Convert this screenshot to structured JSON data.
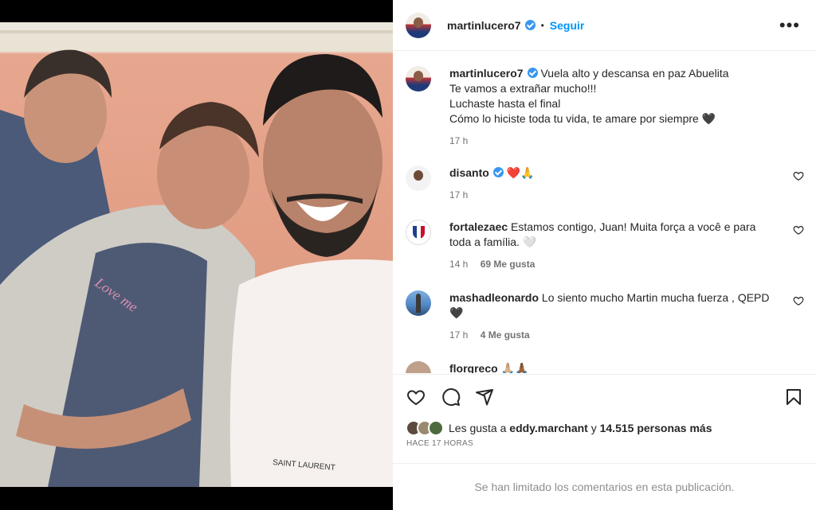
{
  "post": {
    "author": "martinlucero7",
    "follow_label": "Seguir",
    "separator": "•",
    "more_label": "•••"
  },
  "photo": {
    "shirt_text": "SAINT LAURENT",
    "tshirt_print": "Love me"
  },
  "caption": {
    "username": "martinlucero7",
    "lines": [
      "Vuela alto y descansa en paz Abuelita",
      "Te vamos a extrañar mucho!!!",
      "Luchaste hasta el final",
      "Cómo lo hiciste toda tu vida, te amare por siempre 🖤"
    ],
    "time": "17 h"
  },
  "comments": [
    {
      "username": "disanto",
      "text": "❤️🙏",
      "time": "17 h",
      "likes": ""
    },
    {
      "username": "fortalezaec",
      "text": "Estamos contigo, Juan! Muita força a você e para toda a família. 🤍",
      "time": "14 h",
      "likes": "69 Me gusta"
    },
    {
      "username": "mashadleonardo",
      "text": "Lo siento mucho Martin mucha fuerza , QEPD 🖤",
      "time": "17 h",
      "likes": "4 Me gusta"
    },
    {
      "username": "florgreco",
      "text": "🙏🏼🙏🏾",
      "time": "",
      "likes": ""
    }
  ],
  "likes": {
    "prefix": "Les gusta a",
    "user": "eddy.marchant",
    "joiner": "y",
    "count": "14.515 personas más"
  },
  "timeago": "HACE 17 HORAS",
  "comments_limited": "Se han limitado los comentarios en esta publicación.",
  "icons": {
    "like": "heart-icon",
    "comment": "comment-icon",
    "share": "share-icon",
    "save": "bookmark-icon",
    "verified": "verified-badge-icon",
    "more": "more-options-icon"
  },
  "colors": {
    "accent": "#0095f6",
    "verified": "#3897f0",
    "text": "#262626",
    "muted": "#737373"
  }
}
